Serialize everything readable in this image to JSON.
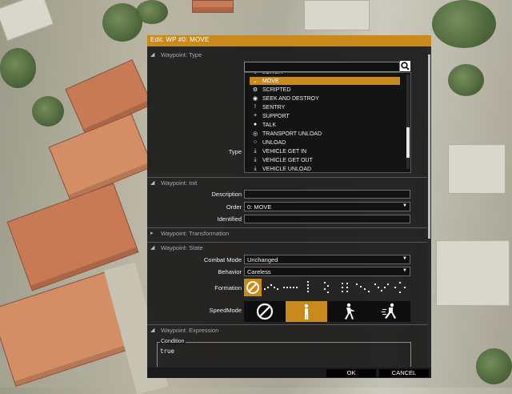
{
  "dialog": {
    "title": "Edit: WP #0: MOVE",
    "ok_label": "OK",
    "cancel_label": "CANCEL"
  },
  "sections": {
    "type": {
      "header": "Waypoint: Type",
      "field_label": "Type",
      "search_value": "",
      "items": [
        {
          "label": "LOITER",
          "icon": "loiter-icon",
          "glyph": "↻",
          "selected": false
        },
        {
          "label": "MOVE",
          "icon": "chevron-down-icon",
          "glyph": "⌄",
          "selected": true
        },
        {
          "label": "SCRIPTED",
          "icon": "gear-icon",
          "glyph": "⚙",
          "selected": false
        },
        {
          "label": "SEEK AND DESTROY",
          "icon": "eye-icon",
          "glyph": "◉",
          "selected": false
        },
        {
          "label": "SENTRY",
          "icon": "exclamation-icon",
          "glyph": "!",
          "selected": false
        },
        {
          "label": "SUPPORT",
          "icon": "plus-icon",
          "glyph": "+",
          "selected": false
        },
        {
          "label": "TALK",
          "icon": "speech-bubble-icon",
          "glyph": "●",
          "selected": false
        },
        {
          "label": "TRANSPORT UNLOAD",
          "icon": "unload-icon",
          "glyph": "◎",
          "selected": false
        },
        {
          "label": "UNLOAD",
          "icon": "circle-icon",
          "glyph": "○",
          "selected": false
        },
        {
          "label": "VEHICLE GET IN",
          "icon": "download-icon",
          "glyph": "⤓",
          "selected": false
        },
        {
          "label": "VEHICLE GET OUT",
          "icon": "download-icon",
          "glyph": "⤓",
          "selected": false
        },
        {
          "label": "VEHICLE UNLOAD",
          "icon": "download-icon",
          "glyph": "⤓",
          "selected": false
        }
      ]
    },
    "init": {
      "header": "Waypoint: Init",
      "description_label": "Description",
      "description_value": "",
      "order_label": "Order",
      "order_value": "0: MOVE",
      "identified_label": "Identified",
      "identified_value": ""
    },
    "transformation": {
      "header": "Waypoint: Transformation"
    },
    "state": {
      "header": "Waypoint: State",
      "combat_mode_label": "Combat Mode",
      "combat_mode_value": "Unchanged",
      "behavior_label": "Behavior",
      "behavior_value": "Careless",
      "formation_label": "Formation",
      "speed_mode_label": "SpeedMode",
      "formation_selected": "none",
      "speed_selected": "limited"
    },
    "expression": {
      "header": "Waypoint: Expression",
      "condition_legend": "Condition",
      "condition_value": "true"
    }
  },
  "colors": {
    "accent": "#c8891d",
    "panel": "#1c1c1c",
    "field_bg": "#121212"
  }
}
